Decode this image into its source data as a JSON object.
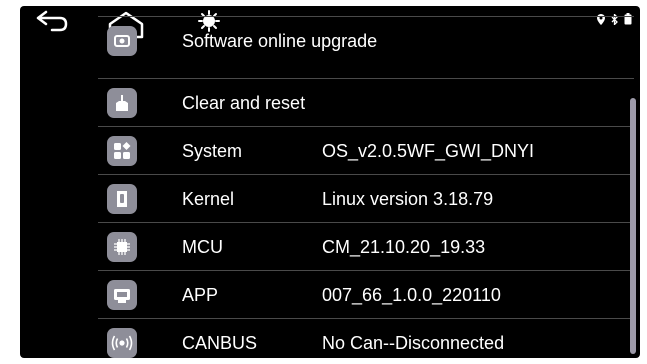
{
  "status_icons": [
    "location-pin-icon",
    "bluetooth-icon",
    "battery-icon"
  ],
  "nav": [
    "back-icon",
    "home-icon",
    "brightness-icon"
  ],
  "rows": [
    {
      "icon": "software-upgrade-icon",
      "label": "Software online upgrade",
      "value": ""
    },
    {
      "icon": "clear-reset-icon",
      "label": "Clear and reset",
      "value": ""
    },
    {
      "icon": "system-icon",
      "label": "System",
      "value": "OS_v2.0.5WF_GWI_DNYI"
    },
    {
      "icon": "kernel-icon",
      "label": "Kernel",
      "value": "Linux version 3.18.79"
    },
    {
      "icon": "mcu-icon",
      "label": "MCU",
      "value": "CM_21.10.20_19.33"
    },
    {
      "icon": "app-icon",
      "label": "APP",
      "value": "007_66_1.0.0_220110"
    },
    {
      "icon": "canbus-icon",
      "label": "CANBUS",
      "value": "No Can--Disconnected"
    }
  ]
}
